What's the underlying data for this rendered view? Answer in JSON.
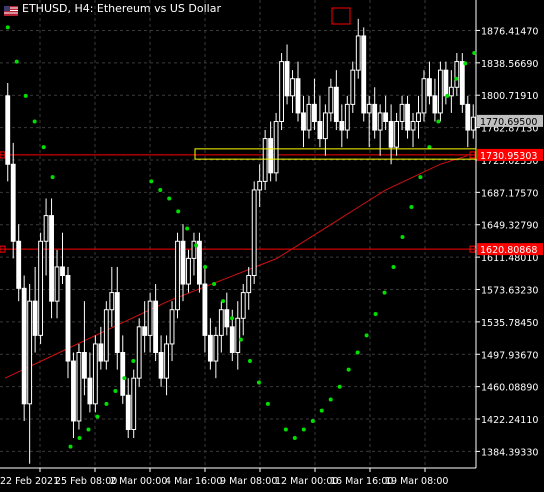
{
  "chart_title": "ETHUSD, H4:  Ethereum vs US Dollar",
  "icons": {
    "title_icon": "symbol-flag-icon"
  },
  "colors": {
    "background": "#000000",
    "grid": "#3a3a3a",
    "candle": "#ffffff",
    "sar": "#00e000",
    "ma": "#d01010",
    "level": "#ff0000",
    "box": "#ffff00",
    "current_price_box": "#c0c0c0",
    "axis_text": "#ffffff"
  },
  "price_axis": {
    "ticks": [
      "1876.41470",
      "1838.56690",
      "1800.71910",
      "1762.87130",
      "1725.02350",
      "1687.17570",
      "1649.32790",
      "1611.48010",
      "1573.63230",
      "1535.78450",
      "1497.93670",
      "1460.08890",
      "1422.24110",
      "1384.39330"
    ],
    "current_price": "1770.69500",
    "level_upper": "1730.95303",
    "level_lower": "1620.80868"
  },
  "time_axis": {
    "labels": [
      "22 Feb 2021",
      "25 Feb 08:00",
      "2 Mar 00:00",
      "4 Mar 16:00",
      "9 Mar 08:00",
      "12 Mar 00:00",
      "16 Mar 16:00",
      "19 Mar 08:00"
    ]
  },
  "chart_data": {
    "type": "candlestick",
    "title": "ETHUSD, H4:  Ethereum vs US Dollar",
    "symbol": "ETHUSD",
    "timeframe": "H4",
    "ylim": [
      1365,
      1912
    ],
    "x_labels": [
      "22 Feb 2021",
      "25 Feb 08:00",
      "2 Mar 00:00",
      "4 Mar 16:00",
      "9 Mar 08:00",
      "12 Mar 00:00",
      "16 Mar 16:00",
      "19 Mar 08:00"
    ],
    "candles_ohlc": [
      [
        1800,
        1815,
        1700,
        1720
      ],
      [
        1720,
        1745,
        1610,
        1630
      ],
      [
        1630,
        1650,
        1560,
        1575
      ],
      [
        1575,
        1590,
        1420,
        1440
      ],
      [
        1440,
        1580,
        1370,
        1560
      ],
      [
        1560,
        1600,
        1500,
        1520
      ],
      [
        1520,
        1640,
        1510,
        1630
      ],
      [
        1630,
        1680,
        1590,
        1660
      ],
      [
        1660,
        1680,
        1540,
        1560
      ],
      [
        1560,
        1620,
        1540,
        1600
      ],
      [
        1600,
        1640,
        1580,
        1590
      ],
      [
        1590,
        1600,
        1470,
        1490
      ],
      [
        1490,
        1500,
        1400,
        1420
      ],
      [
        1420,
        1510,
        1410,
        1500
      ],
      [
        1500,
        1560,
        1450,
        1470
      ],
      [
        1470,
        1500,
        1430,
        1440
      ],
      [
        1440,
        1520,
        1430,
        1510
      ],
      [
        1510,
        1530,
        1480,
        1490
      ],
      [
        1490,
        1560,
        1480,
        1550
      ],
      [
        1550,
        1600,
        1530,
        1570
      ],
      [
        1570,
        1600,
        1480,
        1500
      ],
      [
        1500,
        1520,
        1440,
        1450
      ],
      [
        1450,
        1470,
        1400,
        1410
      ],
      [
        1410,
        1480,
        1400,
        1470
      ],
      [
        1470,
        1540,
        1460,
        1530
      ],
      [
        1530,
        1560,
        1500,
        1520
      ],
      [
        1520,
        1570,
        1500,
        1560
      ],
      [
        1560,
        1580,
        1490,
        1500
      ],
      [
        1500,
        1520,
        1460,
        1470
      ],
      [
        1470,
        1520,
        1450,
        1510
      ],
      [
        1510,
        1560,
        1490,
        1550
      ],
      [
        1550,
        1640,
        1540,
        1630
      ],
      [
        1630,
        1650,
        1560,
        1580
      ],
      [
        1580,
        1620,
        1570,
        1610
      ],
      [
        1610,
        1640,
        1590,
        1630
      ],
      [
        1630,
        1640,
        1570,
        1580
      ],
      [
        1580,
        1600,
        1500,
        1520
      ],
      [
        1520,
        1540,
        1480,
        1490
      ],
      [
        1490,
        1530,
        1470,
        1520
      ],
      [
        1520,
        1560,
        1500,
        1550
      ],
      [
        1550,
        1570,
        1520,
        1530
      ],
      [
        1530,
        1550,
        1490,
        1500
      ],
      [
        1500,
        1560,
        1480,
        1540
      ],
      [
        1540,
        1580,
        1520,
        1570
      ],
      [
        1570,
        1600,
        1550,
        1590
      ],
      [
        1590,
        1700,
        1580,
        1690
      ],
      [
        1690,
        1720,
        1670,
        1700
      ],
      [
        1700,
        1760,
        1690,
        1750
      ],
      [
        1750,
        1770,
        1700,
        1710
      ],
      [
        1710,
        1780,
        1700,
        1770
      ],
      [
        1770,
        1850,
        1760,
        1840
      ],
      [
        1840,
        1860,
        1790,
        1800
      ],
      [
        1800,
        1830,
        1780,
        1820
      ],
      [
        1820,
        1840,
        1770,
        1780
      ],
      [
        1780,
        1800,
        1740,
        1760
      ],
      [
        1760,
        1800,
        1750,
        1790
      ],
      [
        1790,
        1820,
        1760,
        1770
      ],
      [
        1770,
        1800,
        1740,
        1750
      ],
      [
        1750,
        1790,
        1730,
        1780
      ],
      [
        1780,
        1820,
        1770,
        1810
      ],
      [
        1810,
        1830,
        1760,
        1770
      ],
      [
        1770,
        1790,
        1740,
        1760
      ],
      [
        1760,
        1800,
        1750,
        1790
      ],
      [
        1790,
        1840,
        1780,
        1830
      ],
      [
        1830,
        1890,
        1820,
        1870
      ],
      [
        1870,
        1880,
        1770,
        1780
      ],
      [
        1780,
        1800,
        1740,
        1790
      ],
      [
        1790,
        1810,
        1750,
        1760
      ],
      [
        1760,
        1790,
        1730,
        1780
      ],
      [
        1780,
        1800,
        1760,
        1770
      ],
      [
        1770,
        1790,
        1720,
        1740
      ],
      [
        1740,
        1780,
        1730,
        1770
      ],
      [
        1770,
        1800,
        1760,
        1790
      ],
      [
        1790,
        1800,
        1750,
        1760
      ],
      [
        1760,
        1780,
        1740,
        1770
      ],
      [
        1770,
        1800,
        1750,
        1780
      ],
      [
        1780,
        1830,
        1770,
        1820
      ],
      [
        1820,
        1840,
        1790,
        1800
      ],
      [
        1800,
        1820,
        1770,
        1780
      ],
      [
        1780,
        1840,
        1770,
        1830
      ],
      [
        1830,
        1840,
        1790,
        1800
      ],
      [
        1800,
        1830,
        1780,
        1810
      ],
      [
        1810,
        1850,
        1800,
        1840
      ],
      [
        1840,
        1850,
        1780,
        1790
      ],
      [
        1790,
        1800,
        1740,
        1760
      ],
      [
        1760,
        1790,
        1750,
        1775
      ]
    ],
    "sar_points": [
      [
        0,
        1880
      ],
      [
        2,
        1840
      ],
      [
        4,
        1800
      ],
      [
        6,
        1770
      ],
      [
        8,
        1740
      ],
      [
        10,
        1705
      ],
      [
        14,
        1390
      ],
      [
        16,
        1400
      ],
      [
        18,
        1410
      ],
      [
        20,
        1425
      ],
      [
        22,
        1440
      ],
      [
        24,
        1455
      ],
      [
        26,
        1470
      ],
      [
        28,
        1490
      ],
      [
        32,
        1700
      ],
      [
        34,
        1690
      ],
      [
        36,
        1680
      ],
      [
        38,
        1665
      ],
      [
        40,
        1645
      ],
      [
        42,
        1625
      ],
      [
        44,
        1600
      ],
      [
        46,
        1580
      ],
      [
        48,
        1560
      ],
      [
        50,
        1540
      ],
      [
        52,
        1515
      ],
      [
        54,
        1490
      ],
      [
        56,
        1465
      ],
      [
        58,
        1440
      ],
      [
        62,
        1410
      ],
      [
        64,
        1400
      ],
      [
        66,
        1410
      ],
      [
        68,
        1420
      ],
      [
        70,
        1432
      ],
      [
        72,
        1445
      ],
      [
        74,
        1460
      ],
      [
        76,
        1480
      ],
      [
        78,
        1500
      ],
      [
        80,
        1520
      ],
      [
        82,
        1545
      ],
      [
        84,
        1570
      ],
      [
        86,
        1600
      ],
      [
        88,
        1635
      ],
      [
        90,
        1670
      ],
      [
        92,
        1705
      ],
      [
        94,
        1740
      ],
      [
        96,
        1770
      ],
      [
        98,
        1800
      ],
      [
        100,
        1820
      ],
      [
        102,
        1838
      ],
      [
        104,
        1850
      ]
    ],
    "ma_points": [
      [
        0,
        1470
      ],
      [
        20,
        1500
      ],
      [
        40,
        1530
      ],
      [
        60,
        1560
      ],
      [
        80,
        1585
      ],
      [
        100,
        1610
      ],
      [
        110,
        1630
      ],
      [
        120,
        1650
      ],
      [
        130,
        1670
      ],
      [
        140,
        1690
      ],
      [
        150,
        1705
      ],
      [
        160,
        1720
      ],
      [
        170,
        1730
      ]
    ],
    "levels": [
      1730.95303,
      1620.80868
    ]
  }
}
